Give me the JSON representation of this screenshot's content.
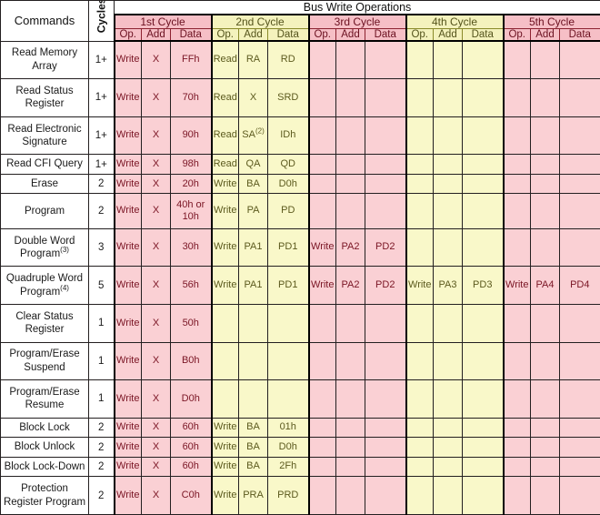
{
  "table": {
    "header": {
      "commands_label": "Commands",
      "cycles_label": "Cycles",
      "bus_write_operations_label": "Bus Write Operations",
      "cycle_groups": [
        {
          "label": "1st Cycle",
          "tone": "pink"
        },
        {
          "label": "2nd Cycle",
          "tone": "yellow"
        },
        {
          "label": "3rd Cycle",
          "tone": "pink"
        },
        {
          "label": "4th Cycle",
          "tone": "yellow"
        },
        {
          "label": "5th Cycle",
          "tone": "pink"
        }
      ],
      "sub_columns": [
        "Op.",
        "Add",
        "Data"
      ]
    },
    "rows": [
      {
        "command": "Read Memory Array",
        "command_line1": "Read Memory",
        "command_line2": "Array",
        "cycles": "1+",
        "cells": [
          "Write",
          "X",
          "FFh",
          "Read",
          "RA",
          "RD",
          "",
          "",
          "",
          "",
          "",
          "",
          "",
          "",
          ""
        ]
      },
      {
        "command": "Read Status Register",
        "command_line1": "Read Status",
        "command_line2": "Register",
        "cycles": "1+",
        "cells": [
          "Write",
          "X",
          "70h",
          "Read",
          "X",
          "SRD",
          "",
          "",
          "",
          "",
          "",
          "",
          "",
          "",
          ""
        ]
      },
      {
        "command": "Read Electronic Signature",
        "command_line1": "Read Electronic",
        "command_line2": "Signature",
        "cycles": "1+",
        "cells": [
          "Write",
          "X",
          "90h",
          "Read",
          "SA(2)",
          "IDh",
          "",
          "",
          "",
          "",
          "",
          "",
          "",
          "",
          ""
        ],
        "cell_sup": {
          "4": "(2)"
        }
      },
      {
        "command": "Read CFI Query",
        "command_line1": "Read CFI Query",
        "command_line2": "",
        "cycles": "1+",
        "cells": [
          "Write",
          "X",
          "98h",
          "Read",
          "QA",
          "QD",
          "",
          "",
          "",
          "",
          "",
          "",
          "",
          "",
          ""
        ]
      },
      {
        "command": "Erase",
        "command_line1": "Erase",
        "command_line2": "",
        "cycles": "2",
        "cells": [
          "Write",
          "X",
          "20h",
          "Write",
          "BA",
          "D0h",
          "",
          "",
          "",
          "",
          "",
          "",
          "",
          "",
          ""
        ]
      },
      {
        "command": "Program",
        "command_line1": "Program",
        "command_line2": "",
        "cycles": "2",
        "cells": [
          "Write",
          "X",
          "40h or 10h",
          "Write",
          "PA",
          "PD",
          "",
          "",
          "",
          "",
          "",
          "",
          "",
          "",
          ""
        ]
      },
      {
        "command": "Double Word Program(3)",
        "command_line1": "Double Word",
        "command_line2": "Program(3)",
        "command_line2_base": "Program",
        "command_line2_sup": "(3)",
        "cycles": "3",
        "cells": [
          "Write",
          "X",
          "30h",
          "Write",
          "PA1",
          "PD1",
          "Write",
          "PA2",
          "PD2",
          "",
          "",
          "",
          "",
          "",
          ""
        ]
      },
      {
        "command": "Quadruple Word Program(4)",
        "command_line1": "Quadruple Word",
        "command_line2": "Program(4)",
        "command_line2_base": "Program",
        "command_line2_sup": "(4)",
        "cycles": "5",
        "cells": [
          "Write",
          "X",
          "56h",
          "Write",
          "PA1",
          "PD1",
          "Write",
          "PA2",
          "PD2",
          "Write",
          "PA3",
          "PD3",
          "Write",
          "PA4",
          "PD4"
        ]
      },
      {
        "command": "Clear Status Register",
        "command_line1": "Clear Status",
        "command_line2": "Register",
        "cycles": "1",
        "cells": [
          "Write",
          "X",
          "50h",
          "",
          "",
          "",
          "",
          "",
          "",
          "",
          "",
          "",
          "",
          "",
          ""
        ]
      },
      {
        "command": "Program/Erase Suspend",
        "command_line1": "Program/Erase",
        "command_line2": "Suspend",
        "cycles": "1",
        "cells": [
          "Write",
          "X",
          "B0h",
          "",
          "",
          "",
          "",
          "",
          "",
          "",
          "",
          "",
          "",
          "",
          ""
        ]
      },
      {
        "command": "Program/Erase Resume",
        "command_line1": "Program/Erase",
        "command_line2": "Resume",
        "cycles": "1",
        "cells": [
          "Write",
          "X",
          "D0h",
          "",
          "",
          "",
          "",
          "",
          "",
          "",
          "",
          "",
          "",
          "",
          ""
        ]
      },
      {
        "command": "Block Lock",
        "command_line1": "Block Lock",
        "command_line2": "",
        "cycles": "2",
        "cells": [
          "Write",
          "X",
          "60h",
          "Write",
          "BA",
          "01h",
          "",
          "",
          "",
          "",
          "",
          "",
          "",
          "",
          ""
        ]
      },
      {
        "command": "Block Unlock",
        "command_line1": "Block Unlock",
        "command_line2": "",
        "cycles": "2",
        "cells": [
          "Write",
          "X",
          "60h",
          "Write",
          "BA",
          "D0h",
          "",
          "",
          "",
          "",
          "",
          "",
          "",
          "",
          ""
        ]
      },
      {
        "command": "Block Lock-Down",
        "command_line1": "Block Lock-Down",
        "command_line2": "",
        "cycles": "2",
        "cells": [
          "Write",
          "X",
          "60h",
          "Write",
          "BA",
          "2Fh",
          "",
          "",
          "",
          "",
          "",
          "",
          "",
          "",
          ""
        ]
      },
      {
        "command": "Protection Register Program",
        "command_line1": "Protection",
        "command_line2": "Register Program",
        "cycles": "2",
        "cells": [
          "Write",
          "X",
          "C0h",
          "Write",
          "PRA",
          "PRD",
          "",
          "",
          "",
          "",
          "",
          "",
          "",
          "",
          ""
        ]
      }
    ]
  },
  "colors": {
    "pink_body": "#fad0d4",
    "pink_header": "#f6bfc6",
    "pink_border": "#8c2230",
    "pink_text": "#7a1524",
    "yellow_body": "#f9f8c9",
    "yellow_header": "#f4f2bd",
    "yellow_border": "#8a8a2a",
    "yellow_text": "#5c5a1e",
    "frame": "#000000",
    "background": "#ffffff"
  }
}
